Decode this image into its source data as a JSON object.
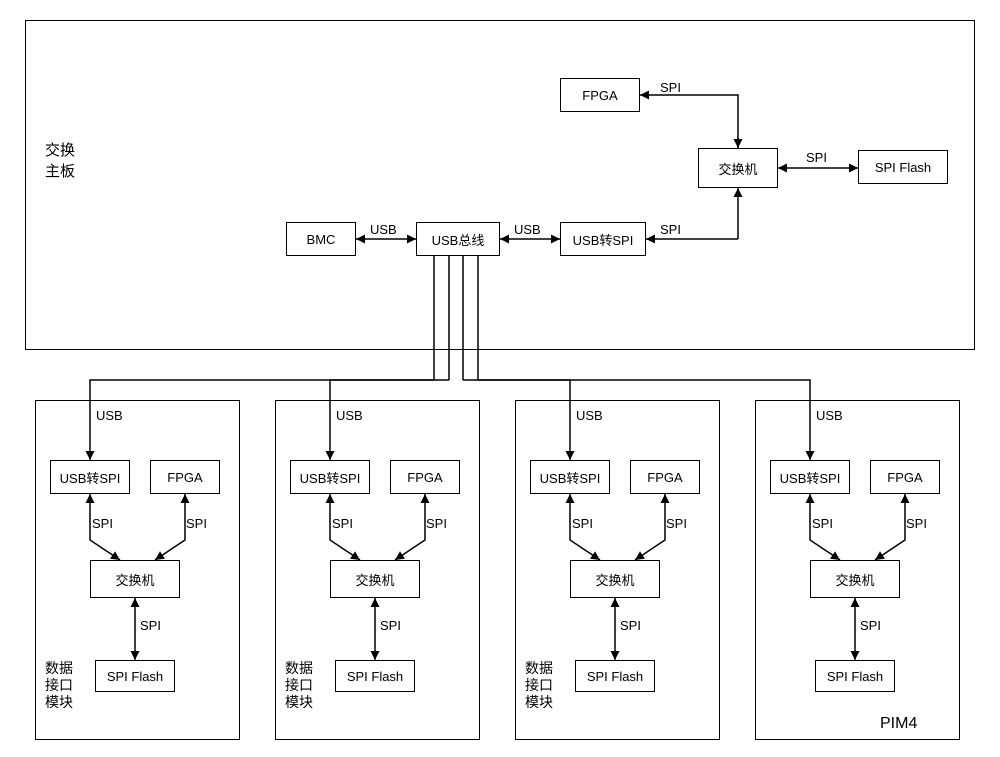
{
  "mainboard": {
    "title": "交换\n主板",
    "bmc": "BMC",
    "usb_bus": "USB总线",
    "usb_to_spi": "USB转SPI",
    "switch": "交换机",
    "fpga": "FPGA",
    "spi_flash": "SPI Flash",
    "edge_usb1": "USB",
    "edge_usb2": "USB",
    "edge_spi1": "SPI",
    "edge_spi2": "SPI",
    "edge_spi3": "SPI"
  },
  "pims": [
    {
      "title": "数据\n接口\n模块",
      "usb_to_spi": "USB转SPI",
      "fpga": "FPGA",
      "switch": "交换机",
      "spi_flash": "SPI Flash",
      "usb": "USB",
      "spi1": "SPI",
      "spi2": "SPI",
      "spi3": "SPI"
    },
    {
      "title": "数据\n接口\n模块",
      "usb_to_spi": "USB转SPI",
      "fpga": "FPGA",
      "switch": "交换机",
      "spi_flash": "SPI Flash",
      "usb": "USB",
      "spi1": "SPI",
      "spi2": "SPI",
      "spi3": "SPI"
    },
    {
      "title": "数据\n接口\n模块",
      "usb_to_spi": "USB转SPI",
      "fpga": "FPGA",
      "switch": "交换机",
      "spi_flash": "SPI Flash",
      "usb": "USB",
      "spi1": "SPI",
      "spi2": "SPI",
      "spi3": "SPI"
    },
    {
      "title": "PIM4",
      "usb_to_spi": "USB转SPI",
      "fpga": "FPGA",
      "switch": "交换机",
      "spi_flash": "SPI Flash",
      "usb": "USB",
      "spi1": "SPI",
      "spi2": "SPI",
      "spi3": "SPI"
    }
  ],
  "chart_data": {
    "type": "diagram",
    "title": "交换主板与数据接口模块 (PIM) 架构",
    "nodes": [
      {
        "id": "mainboard",
        "label": "交换主板",
        "type": "container"
      },
      {
        "id": "bmc",
        "label": "BMC",
        "parent": "mainboard"
      },
      {
        "id": "usb_bus",
        "label": "USB总线",
        "parent": "mainboard"
      },
      {
        "id": "usb2spi_main",
        "label": "USB转SPI",
        "parent": "mainboard"
      },
      {
        "id": "switch_main",
        "label": "交换机",
        "parent": "mainboard"
      },
      {
        "id": "fpga_main",
        "label": "FPGA",
        "parent": "mainboard"
      },
      {
        "id": "spiflash_main",
        "label": "SPI Flash",
        "parent": "mainboard"
      },
      {
        "id": "pim1",
        "label": "数据接口模块",
        "type": "container"
      },
      {
        "id": "pim2",
        "label": "数据接口模块",
        "type": "container"
      },
      {
        "id": "pim3",
        "label": "数据接口模块",
        "type": "container"
      },
      {
        "id": "pim4",
        "label": "PIM4",
        "type": "container"
      },
      {
        "id": "usb2spi_p1",
        "label": "USB转SPI",
        "parent": "pim1"
      },
      {
        "id": "fpga_p1",
        "label": "FPGA",
        "parent": "pim1"
      },
      {
        "id": "switch_p1",
        "label": "交换机",
        "parent": "pim1"
      },
      {
        "id": "spiflash_p1",
        "label": "SPI Flash",
        "parent": "pim1"
      },
      {
        "id": "usb2spi_p2",
        "label": "USB转SPI",
        "parent": "pim2"
      },
      {
        "id": "fpga_p2",
        "label": "FPGA",
        "parent": "pim2"
      },
      {
        "id": "switch_p2",
        "label": "交换机",
        "parent": "pim2"
      },
      {
        "id": "spiflash_p2",
        "label": "SPI Flash",
        "parent": "pim2"
      },
      {
        "id": "usb2spi_p3",
        "label": "USB转SPI",
        "parent": "pim3"
      },
      {
        "id": "fpga_p3",
        "label": "FPGA",
        "parent": "pim3"
      },
      {
        "id": "switch_p3",
        "label": "交换机",
        "parent": "pim3"
      },
      {
        "id": "spiflash_p3",
        "label": "SPI Flash",
        "parent": "pim3"
      },
      {
        "id": "usb2spi_p4",
        "label": "USB转SPI",
        "parent": "pim4"
      },
      {
        "id": "fpga_p4",
        "label": "FPGA",
        "parent": "pim4"
      },
      {
        "id": "switch_p4",
        "label": "交换机",
        "parent": "pim4"
      },
      {
        "id": "spiflash_p4",
        "label": "SPI Flash",
        "parent": "pim4"
      }
    ],
    "edges": [
      {
        "from": "bmc",
        "to": "usb_bus",
        "label": "USB",
        "dir": "both"
      },
      {
        "from": "usb_bus",
        "to": "usb2spi_main",
        "label": "USB",
        "dir": "both"
      },
      {
        "from": "usb2spi_main",
        "to": "switch_main",
        "label": "SPI",
        "dir": "both"
      },
      {
        "from": "switch_main",
        "to": "fpga_main",
        "label": "SPI",
        "dir": "both"
      },
      {
        "from": "switch_main",
        "to": "spiflash_main",
        "label": "SPI",
        "dir": "both"
      },
      {
        "from": "usb_bus",
        "to": "usb2spi_p1",
        "label": "USB",
        "dir": "both"
      },
      {
        "from": "usb_bus",
        "to": "usb2spi_p2",
        "label": "USB",
        "dir": "both"
      },
      {
        "from": "usb_bus",
        "to": "usb2spi_p3",
        "label": "USB",
        "dir": "both"
      },
      {
        "from": "usb_bus",
        "to": "usb2spi_p4",
        "label": "USB",
        "dir": "both"
      },
      {
        "from": "usb2spi_p1",
        "to": "switch_p1",
        "label": "SPI",
        "dir": "both"
      },
      {
        "from": "fpga_p1",
        "to": "switch_p1",
        "label": "SPI",
        "dir": "both"
      },
      {
        "from": "switch_p1",
        "to": "spiflash_p1",
        "label": "SPI",
        "dir": "both"
      },
      {
        "from": "usb2spi_p2",
        "to": "switch_p2",
        "label": "SPI",
        "dir": "both"
      },
      {
        "from": "fpga_p2",
        "to": "switch_p2",
        "label": "SPI",
        "dir": "both"
      },
      {
        "from": "switch_p2",
        "to": "spiflash_p2",
        "label": "SPI",
        "dir": "both"
      },
      {
        "from": "usb2spi_p3",
        "to": "switch_p3",
        "label": "SPI",
        "dir": "both"
      },
      {
        "from": "fpga_p3",
        "to": "switch_p3",
        "label": "SPI",
        "dir": "both"
      },
      {
        "from": "switch_p3",
        "to": "spiflash_p3",
        "label": "SPI",
        "dir": "both"
      },
      {
        "from": "usb2spi_p4",
        "to": "switch_p4",
        "label": "SPI",
        "dir": "both"
      },
      {
        "from": "fpga_p4",
        "to": "switch_p4",
        "label": "SPI",
        "dir": "both"
      },
      {
        "from": "switch_p4",
        "to": "spiflash_p4",
        "label": "SPI",
        "dir": "both"
      }
    ]
  }
}
